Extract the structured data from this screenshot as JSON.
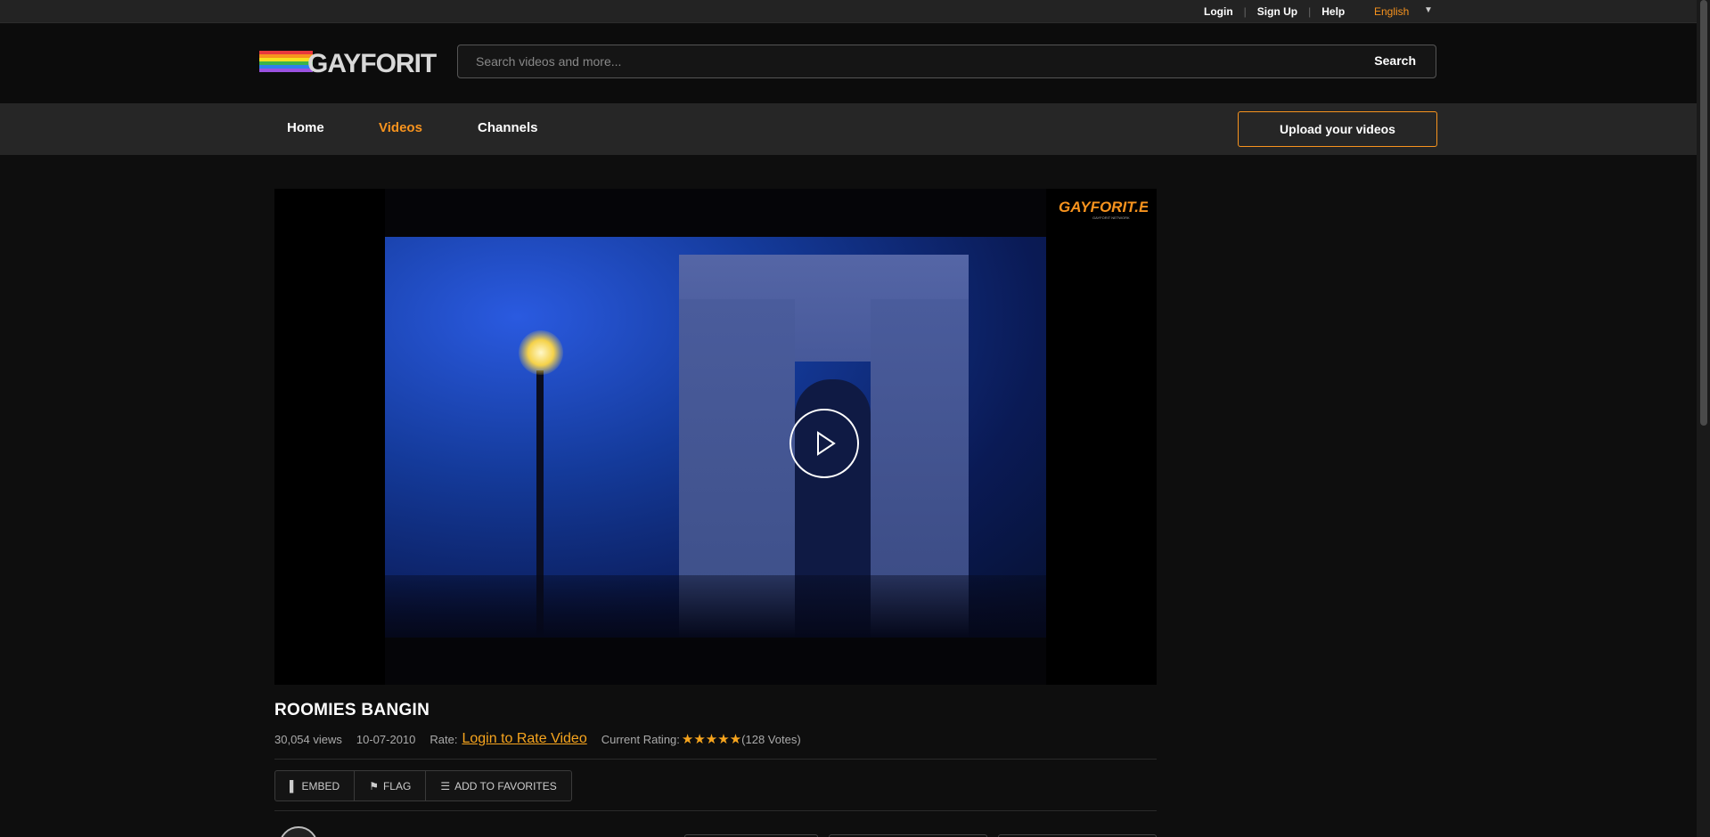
{
  "topbar": {
    "login": "Login",
    "signup": "Sign Up",
    "help": "Help",
    "language": "English"
  },
  "header": {
    "logo_text": "GAYFORIT",
    "search_placeholder": "Search videos and more...",
    "search_button": "Search"
  },
  "nav": {
    "items": [
      {
        "label": "Home",
        "active": false
      },
      {
        "label": "Videos",
        "active": true
      },
      {
        "label": "Channels",
        "active": false
      }
    ],
    "upload_button": "Upload your videos"
  },
  "player": {
    "watermark": "GAYFORIT.EU",
    "watermark_sub": "GAYFORIT NETWORK"
  },
  "video": {
    "title": "ROOMIES BANGIN",
    "views": "30,054 views",
    "date": "10-07-2010",
    "rate_label": "Rate:",
    "rate_link": "Login to Rate Video",
    "rating_label": "Current Rating:",
    "rating_value": 5,
    "votes": "(128 Votes)"
  },
  "actions": {
    "embed": "EMBED",
    "flag": "FLAG",
    "favorites": "ADD TO FAVORITES"
  },
  "colors": {
    "accent": "#f7931e",
    "star": "#f7a51e",
    "background": "#0e0e0e"
  }
}
